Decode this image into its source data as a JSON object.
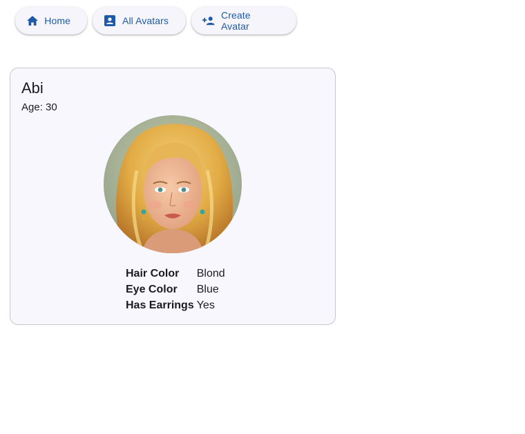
{
  "nav": {
    "home_label": "Home",
    "all_label": "All Avatars",
    "create_label": "Create Avatar",
    "accent_color": "#1f5aa6"
  },
  "avatar": {
    "name": "Abi",
    "age_text": "Age: 30",
    "portrait_icon": "avatar-portrait",
    "attributes": [
      {
        "label": "Hair Color",
        "value": "Blond"
      },
      {
        "label": "Eye Color",
        "value": "Blue"
      },
      {
        "label": "Has Earrings",
        "value": "Yes"
      }
    ]
  }
}
